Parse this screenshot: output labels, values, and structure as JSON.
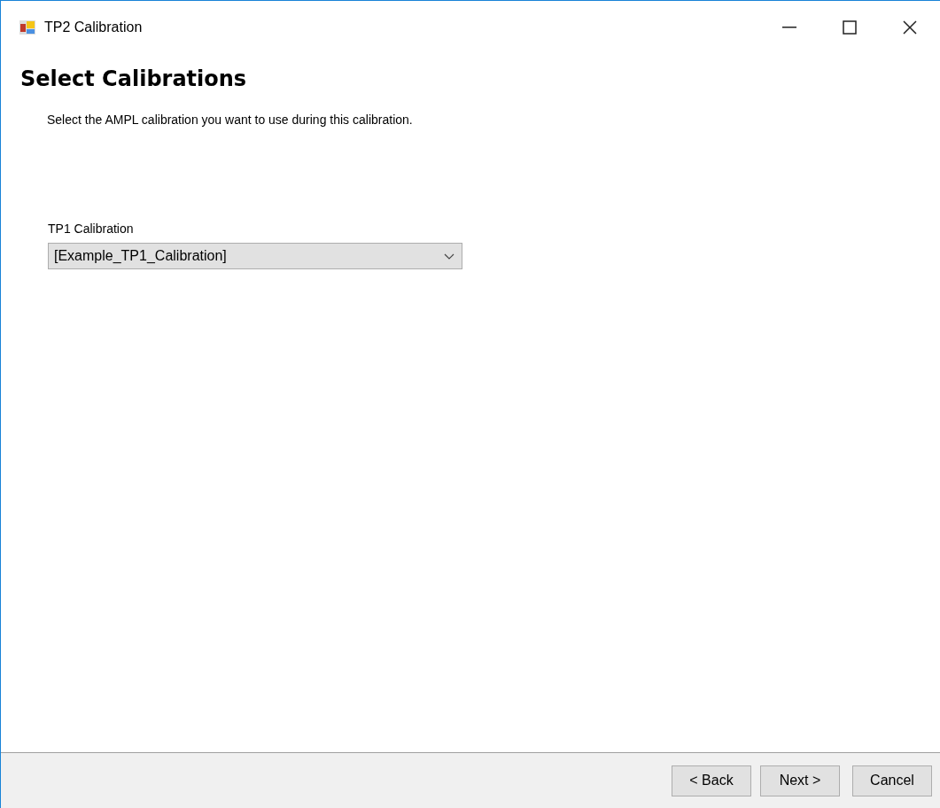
{
  "window": {
    "title": "TP2 Calibration"
  },
  "heading": "Select Calibrations",
  "description": "Select the AMPL calibration you want to use during this calibration.",
  "field": {
    "label": "TP1 Calibration",
    "value": "[Example_TP1_Calibration]"
  },
  "buttons": [
    {
      "label": "< Back",
      "kind": "back"
    },
    {
      "label": "Next >",
      "kind": "next"
    },
    {
      "label": "Cancel",
      "kind": "cancel"
    }
  ]
}
